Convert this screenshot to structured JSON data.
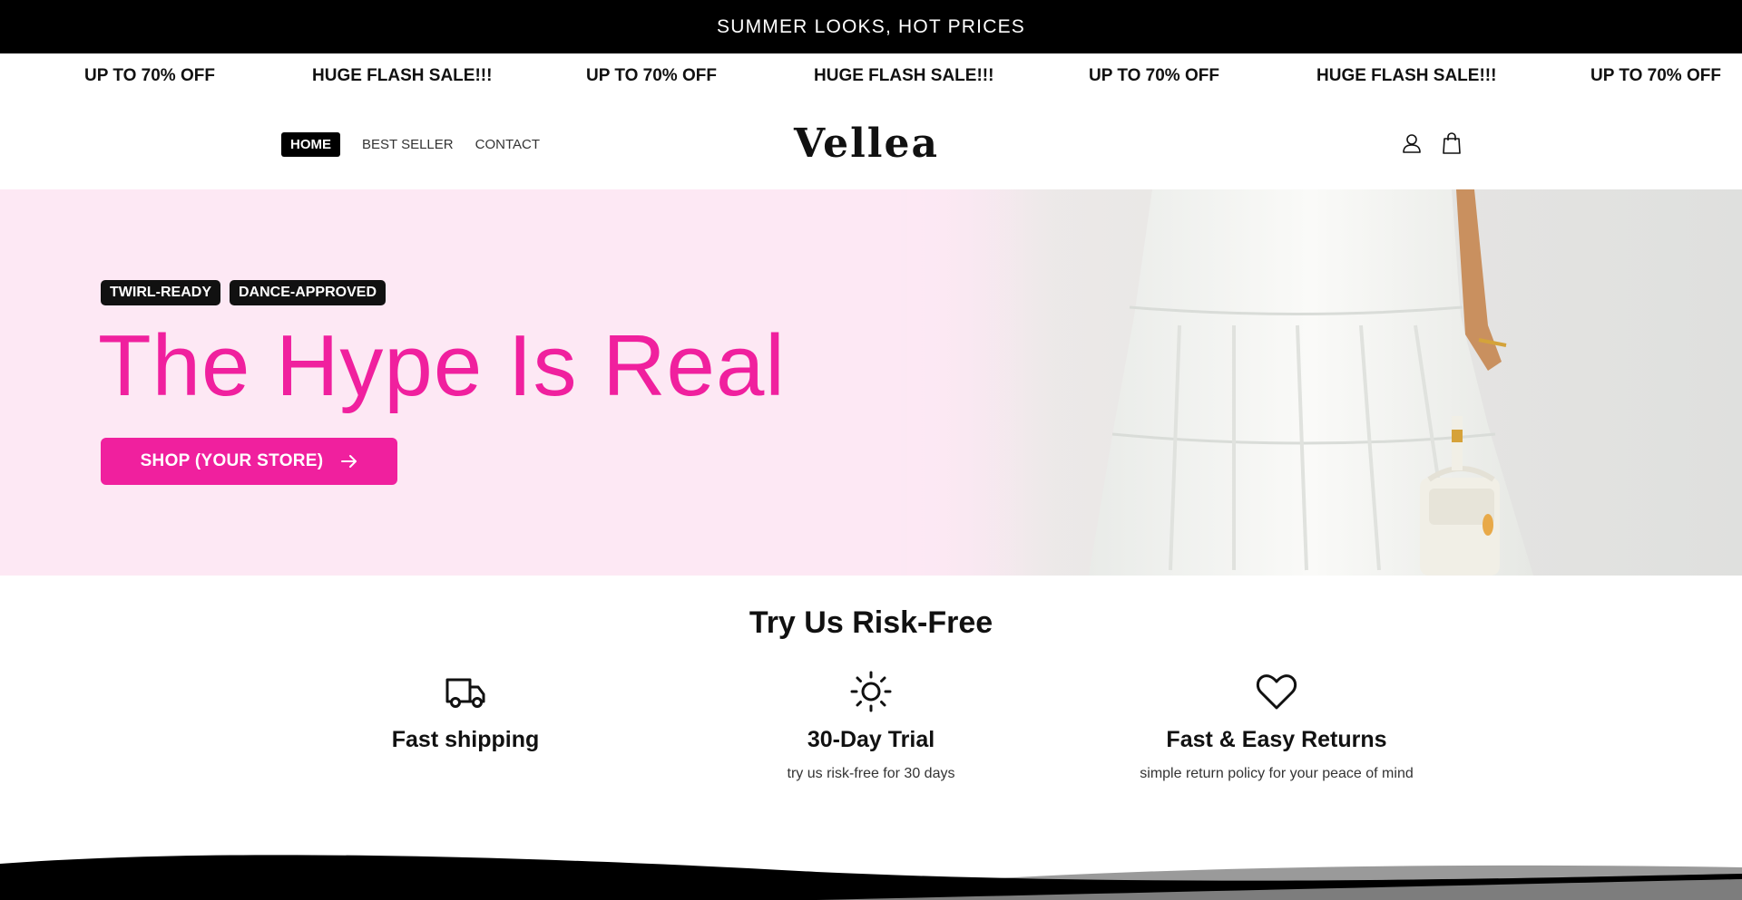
{
  "announcement": {
    "text": "SUMMER LOOKS, HOT PRICES"
  },
  "marquee": {
    "items": [
      "UP TO 70% OFF",
      "HUGE FLASH SALE!!!",
      "UP TO 70% OFF",
      "HUGE FLASH SALE!!!",
      "UP TO 70% OFF",
      "HUGE FLASH SALE!!!",
      "UP TO 70% OFF"
    ]
  },
  "header": {
    "nav": [
      {
        "label": "HOME",
        "active": true
      },
      {
        "label": "BEST SELLER",
        "active": false
      },
      {
        "label": "CONTACT",
        "active": false
      }
    ],
    "logo": "Vellea",
    "icons": [
      "account-icon",
      "cart-icon"
    ]
  },
  "hero": {
    "badges": [
      "TWIRL-READY",
      "DANCE-APPROVED"
    ],
    "title": "The Hype Is Real",
    "button_label": "SHOP (YOUR STORE)",
    "button_icon": "arrow-right-icon"
  },
  "features": {
    "title": "Try Us Risk-Free",
    "items": [
      {
        "icon": "truck-icon",
        "title": "Fast shipping",
        "text": ""
      },
      {
        "icon": "sun-icon",
        "title": "30-Day Trial",
        "text": "try us risk-free for 30 days"
      },
      {
        "icon": "heart-icon",
        "title": "Fast & Easy Returns",
        "text": "simple return policy for your peace of mind"
      }
    ]
  },
  "colors": {
    "accent": "#f0209e",
    "hero_bg": "#fde8f4",
    "dark": "#000000"
  }
}
